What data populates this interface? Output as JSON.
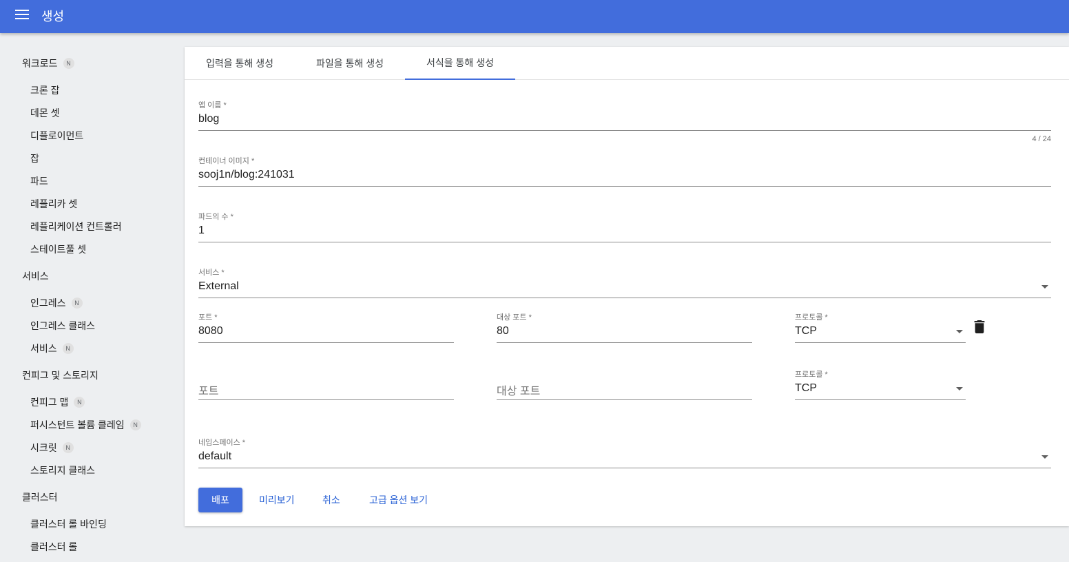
{
  "header": {
    "title": "생성",
    "menu_icon": "menu-icon"
  },
  "sidebar": {
    "sections": [
      {
        "label": "워크로드",
        "badge": "N"
      },
      {
        "label": "서비스"
      },
      {
        "label": "컨피그 및 스토리지"
      },
      {
        "label": "클러스터"
      }
    ],
    "items": [
      {
        "label": "크론 잡"
      },
      {
        "label": "데몬 셋"
      },
      {
        "label": "디플로이먼트"
      },
      {
        "label": "잡"
      },
      {
        "label": "파드"
      },
      {
        "label": "레플리카 셋"
      },
      {
        "label": "레플리케이션 컨트롤러"
      },
      {
        "label": "스테이트풀 셋"
      },
      {
        "label": "인그레스",
        "badge": "N"
      },
      {
        "label": "인그레스 클래스"
      },
      {
        "label": "서비스",
        "badge": "N"
      },
      {
        "label": "컨피그 맵",
        "badge": "N"
      },
      {
        "label": "퍼시스턴트 볼륨 클레임",
        "badge": "N"
      },
      {
        "label": "시크릿",
        "badge": "N"
      },
      {
        "label": "스토리지 클래스"
      },
      {
        "label": "클러스터 롤 바인딩"
      },
      {
        "label": "클러스터 롤"
      }
    ]
  },
  "tabs": [
    {
      "label": "입력을 통해 생성"
    },
    {
      "label": "파일을 통해 생성"
    },
    {
      "label": "서식을 통해 생성",
      "active": true
    }
  ],
  "form": {
    "app_name": {
      "label": "앱 이름 *",
      "value": "blog",
      "counter": "4 / 24"
    },
    "container_image": {
      "label": "컨테이너 이미지 *",
      "value": "sooj1n/blog:241031"
    },
    "pod_count": {
      "label": "파드의 수 *",
      "value": "1"
    },
    "service": {
      "label": "서비스 *",
      "value": "External"
    },
    "ports": [
      {
        "port_label": "포트 *",
        "port_value": "8080",
        "target_label": "대상 포트 *",
        "target_value": "80",
        "protocol_label": "프로토콜 *",
        "protocol_value": "TCP"
      },
      {
        "port_placeholder": "포트",
        "target_placeholder": "대상 포트",
        "protocol_label": "프로토콜 *",
        "protocol_value": "TCP"
      }
    ],
    "namespace": {
      "label": "네임스페이스 *",
      "value": "default"
    }
  },
  "actions": {
    "deploy": "배포",
    "preview": "미리보기",
    "cancel": "취소",
    "advanced": "고급 옵션 보기"
  },
  "colors": {
    "primary": "#426ddc",
    "link": "#2b63d6",
    "background": "#edeff1"
  }
}
